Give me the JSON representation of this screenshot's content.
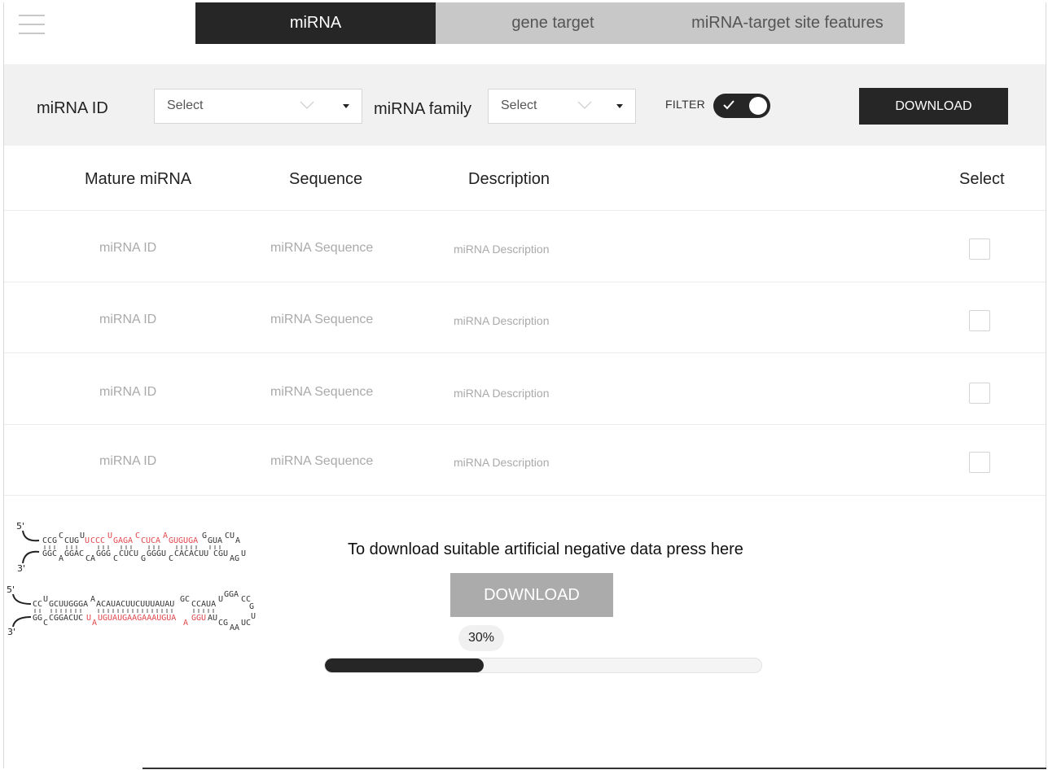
{
  "nav": {
    "menu_icon": "hamburger-icon",
    "tabs": [
      {
        "label": "miRNA",
        "active": true
      },
      {
        "label": "gene target",
        "active": false
      },
      {
        "label": "miRNA-target site features",
        "active": false
      }
    ]
  },
  "filters": {
    "mirna_id_label": "miRNA ID",
    "mirna_id_value": "Select",
    "mirna_family_label": "miRNA family",
    "mirna_family_value": "Select",
    "filter_label": "FILTER",
    "filter_on": true,
    "download_label": "DOWNLOAD"
  },
  "table": {
    "headers": [
      "Mature miRNA",
      "Sequence",
      "Description",
      "Select"
    ],
    "rows": [
      {
        "id": "miRNA ID",
        "sequence": "miRNA Sequence",
        "description": "miRNA Description",
        "selected": false
      },
      {
        "id": "miRNA ID",
        "sequence": "miRNA Sequence",
        "description": "miRNA Description",
        "selected": false
      },
      {
        "id": "miRNA ID",
        "sequence": "miRNA Sequence",
        "description": "miRNA Description",
        "selected": false
      },
      {
        "id": "miRNA ID",
        "sequence": "miRNA Sequence",
        "description": "miRNA Description",
        "selected": false
      }
    ]
  },
  "negative": {
    "text": "To download suitable artificial negative data press here",
    "button_label": "DOWNLOAD",
    "progress_label": "30%",
    "progress_value": 0.3
  },
  "hairpins": {
    "top": {
      "label5": "5'",
      "label3": "3'",
      "strand_top": "CCG CCUG U CCCU GAGA CUCA GUGUGA GUA CU",
      "strand_bottom": "GGC GGAC U GGG CUCU GGGU CACACUU CGU AGU",
      "loop": "A"
    },
    "bottom": {
      "label5": "5'",
      "label3": "3'",
      "strand_top": "CC GCUUGGGA ACAUACUUCUUUAUAU CCAUA GGACC",
      "strand_bottom": "GG CGGACUC UGUAUGAAGAAAUGUA GGU CGAA",
      "loop": "U"
    },
    "colors": {
      "highlight": "#e0484d",
      "base": "#333333"
    }
  },
  "colors": {
    "dark": "#262626",
    "tab_bg": "#c8c8c8",
    "band_bg": "#f1f1f1",
    "muted": "#aaaaaa"
  }
}
